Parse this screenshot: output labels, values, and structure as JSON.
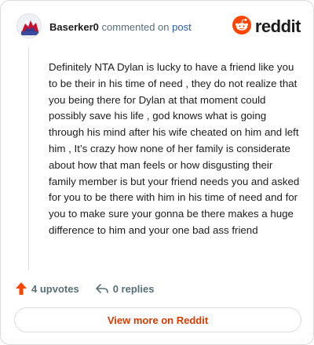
{
  "comment": {
    "username": "Baserker0",
    "action_text": "commented on",
    "post_link": "post",
    "body": "Definitely NTA Dylan is lucky to have a friend like you to be their in his time of need , they do not realize that you being there for Dylan at that moment could possibly save his life , god knows what is going through his mind after his wife cheated on him and left him , It’s crazy how none of her family is considerate about how that man feels or how disgusting their family member is but your friend needs you and asked for you to be there with him in his time of need and for you to make sure your gonna be there makes a huge difference to him and your one bad ass friend"
  },
  "brand": {
    "name": "reddit",
    "icon": "reddit-snoo-icon",
    "color": "#ff4500"
  },
  "stats": {
    "upvotes": "4 upvotes",
    "upvote_icon": "upvote-arrow-icon",
    "replies": "0 replies",
    "reply_icon": "reply-arrow-icon"
  },
  "cta": {
    "label": "View more on Reddit",
    "color": "#d93a00"
  }
}
